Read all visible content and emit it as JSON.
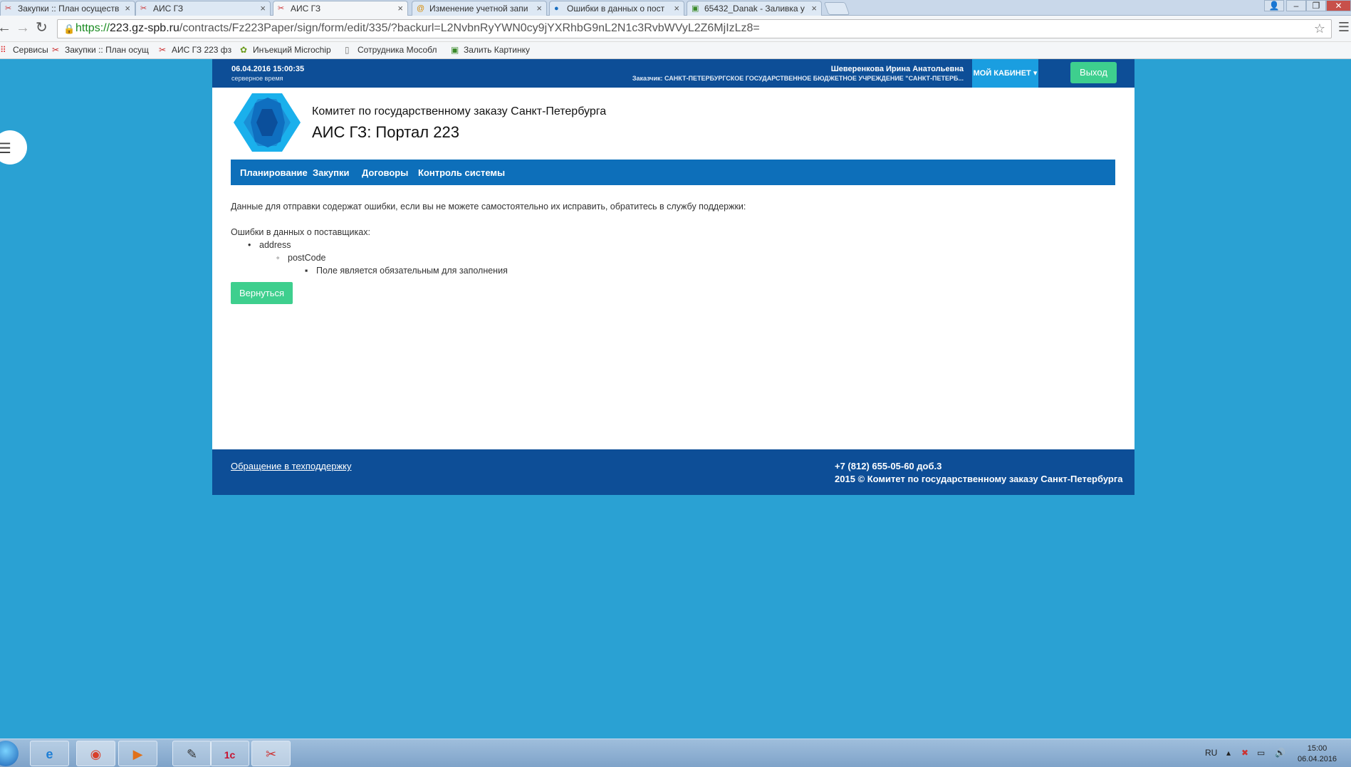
{
  "browser": {
    "tabs": [
      {
        "title": "Закупки :: План осуществ"
      },
      {
        "title": "АИС ГЗ"
      },
      {
        "title": "АИС ГЗ"
      },
      {
        "title": "Изменение учетной запи"
      },
      {
        "title": "Ошибки в данных о пост"
      },
      {
        "title": "65432_Danak - Заливка у"
      }
    ],
    "url_protocol": "https://",
    "url_host": "223.gz-spb.ru",
    "url_path": "/contracts/Fz223Paper/sign/form/edit/335/?backurl=L2NvbnRyYWN0cy9jYXRhbG9nL2N1c3RvbWVyL2Z6MjIzLz8=",
    "bookmarks": [
      {
        "label": "Сервисы"
      },
      {
        "label": "Закупки :: План осущ"
      },
      {
        "label": "АИС ГЗ 223 фз"
      },
      {
        "label": "Инъекций Microchip"
      },
      {
        "label": "Сотрудника Мособл"
      },
      {
        "label": "Залить Картинку"
      }
    ]
  },
  "header": {
    "server_time": "06.04.2016 15:00:35",
    "server_time_label": "серверное время",
    "user_name": "Шеверенкова Ирина Анатольевна",
    "customer": "Заказчик: САНКТ-ПЕТЕРБУРГСКОЕ ГОСУДАРСТВЕННОЕ БЮДЖЕТНОЕ УЧРЕЖДЕНИЕ \"САНКТ-ПЕТЕРБ...",
    "cabinet_label": "МОЙ КАБИНЕТ",
    "logout_label": "Выход"
  },
  "brand": {
    "committee": "Комитет по государственному заказу Санкт-Петербурга",
    "portal": "АИС ГЗ: Портал 223"
  },
  "nav": {
    "items": [
      {
        "label": "Планирование"
      },
      {
        "label": "Закупки"
      },
      {
        "label": "Договоры"
      },
      {
        "label": "Контроль системы"
      }
    ]
  },
  "content": {
    "message": "Данные для отправки содержат ошибки, если вы не можете самостоятельно их исправить, обратитесь в службу поддержки:",
    "errors_heading": "Ошибки в данных о поставщиках:",
    "error_field": "address",
    "error_subfield": "postCode",
    "error_text": "Поле является обязательным для заполнения",
    "back_label": "Вернуться"
  },
  "footer": {
    "support_link": "Обращение в техподдержку",
    "phone": "+7 (812) 655-05-60 доб.3",
    "copyright": "2015 © Комитет по государственному заказу Санкт-Петербурга"
  },
  "taskbar": {
    "lang": "RU",
    "time": "15:00",
    "date": "06.04.2016"
  },
  "colors": {
    "page_bg": "#2aa1d3",
    "header_bg": "#0d4e97",
    "nav_bg": "#0d6fba",
    "accent_green": "#3ecf8e",
    "cabinet_blue": "#1a9ee0"
  }
}
